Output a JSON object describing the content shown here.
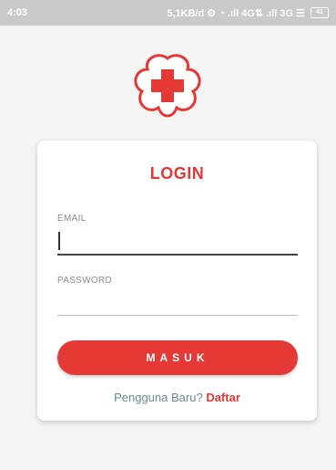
{
  "status_bar": {
    "time": "4:03",
    "indicators": "5,1KB/d ⚙ ◔ .ıll 4G⇅ .ıll 3G ☰",
    "battery": "41"
  },
  "logo": {
    "icon": "red-cross-flower-logo",
    "color": "#e53935"
  },
  "login": {
    "title": "LOGIN",
    "email_label": "EMAIL",
    "email_value": "",
    "password_label": "PASSWORD",
    "password_value": "",
    "submit_label": "MASUK",
    "new_user_text": "Pengguna Baru?",
    "register_label": "Daftar"
  },
  "colors": {
    "accent": "#e53935",
    "secondary_text": "#6a8a9a"
  }
}
